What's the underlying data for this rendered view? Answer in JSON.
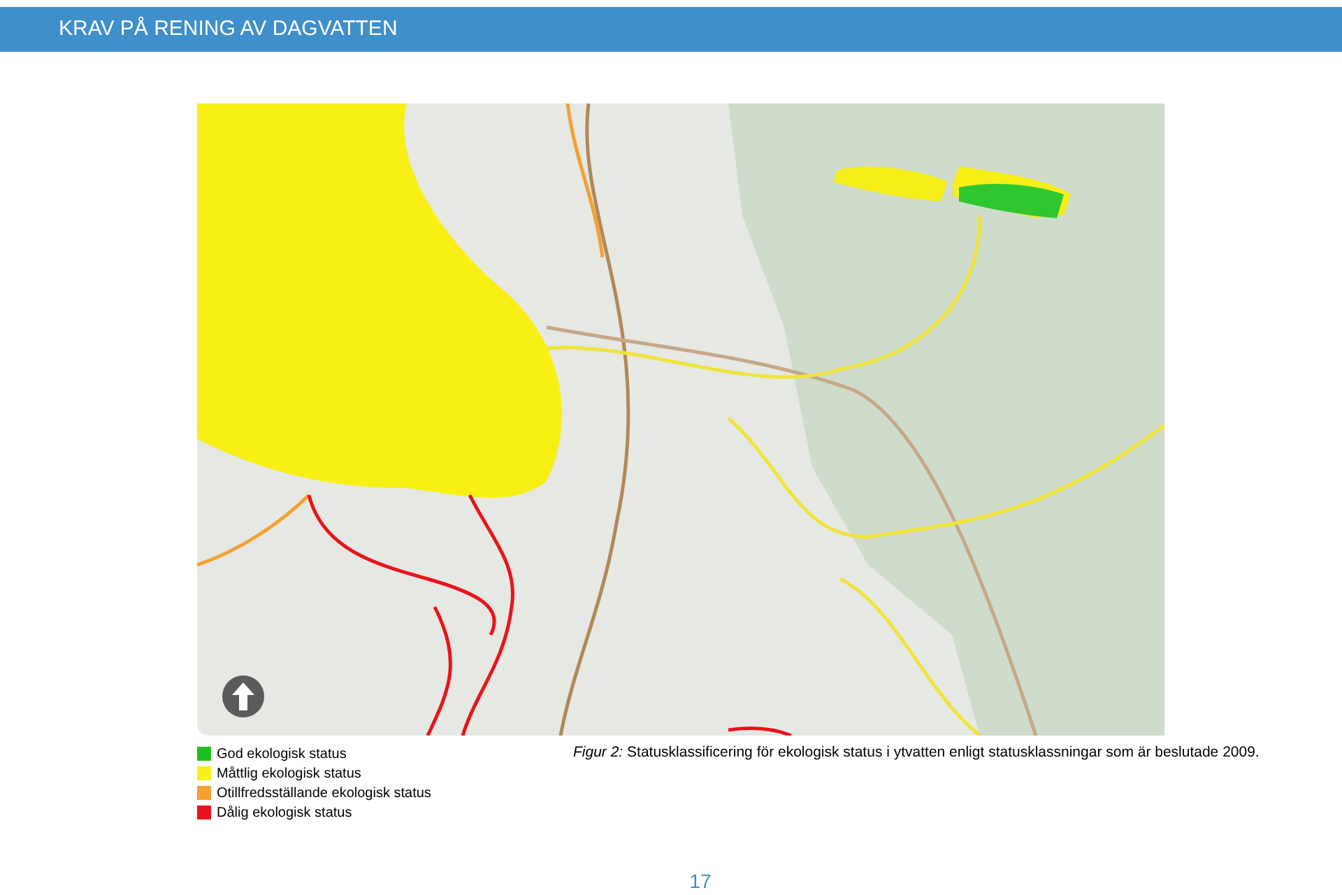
{
  "header": {
    "title": "KRAV PÅ RENING AV DAGVATTEN"
  },
  "legend": [
    {
      "label": "God ekologisk status",
      "color": "#1dbf1d"
    },
    {
      "label": "Måttlig ekologisk status",
      "color": "#f7f01a"
    },
    {
      "label": "Otillfredsställande ekologisk status",
      "color": "#f5a030"
    },
    {
      "label": "Dålig ekologisk status",
      "color": "#e8141c"
    }
  ],
  "caption": "*Figur 2:* Statusklassificering för ekologisk status i ytvatten enligt statusklassningar som är beslutade 2009.",
  "page_number": "17"
}
